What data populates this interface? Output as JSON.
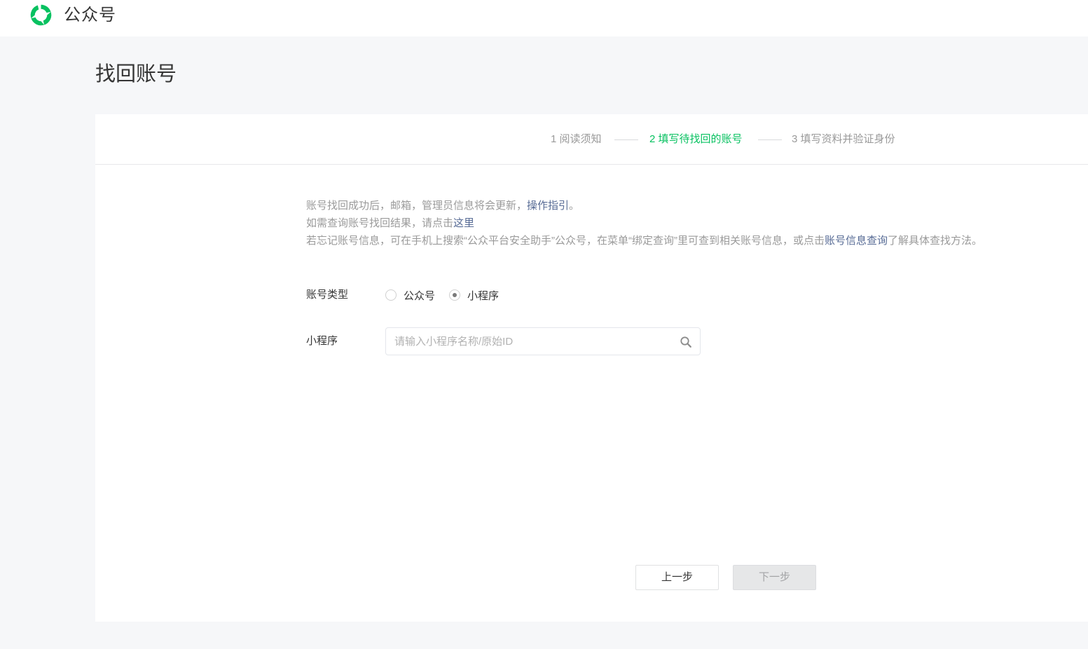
{
  "header": {
    "brand_name": "公众号",
    "logo_icon": "wechat-official-account-logo-icon",
    "brand_color": "#07c160"
  },
  "page": {
    "title": "找回账号"
  },
  "steps": [
    {
      "label": "1 阅读须知",
      "state": "done"
    },
    {
      "label": "2 填写待找回的账号",
      "state": "active"
    },
    {
      "label": "3 填写资料并验证身份",
      "state": "pending"
    }
  ],
  "notes": {
    "line1_text": "账号找回成功后，邮箱，管理员信息将会更新，",
    "line1_link": "操作指引",
    "line1_end": "。",
    "line2_text": "如需查询账号找回结果，请点击",
    "line2_link": "这里",
    "line3_text": "若忘记账号信息，可在手机上搜索“公众平台安全助手”公众号，在菜单“绑定查询”里可查到相关账号信息，或点击",
    "line3_link": "账号信息查询",
    "line3_end": "了解具体查找方法。"
  },
  "form": {
    "type_label": "账号类型",
    "type_options": [
      {
        "label": "公众号",
        "checked": false
      },
      {
        "label": "小程序",
        "checked": true
      }
    ],
    "mini_label": "小程序",
    "search_value": "",
    "search_placeholder": "请输入小程序名称/原始ID",
    "search_icon": "search-icon"
  },
  "buttons": {
    "prev": "上一步",
    "next": "下一步",
    "next_disabled": true
  },
  "colors": {
    "accent_green": "#07c160",
    "link_blue": "#576b95",
    "muted_text": "#9a9a9a"
  }
}
